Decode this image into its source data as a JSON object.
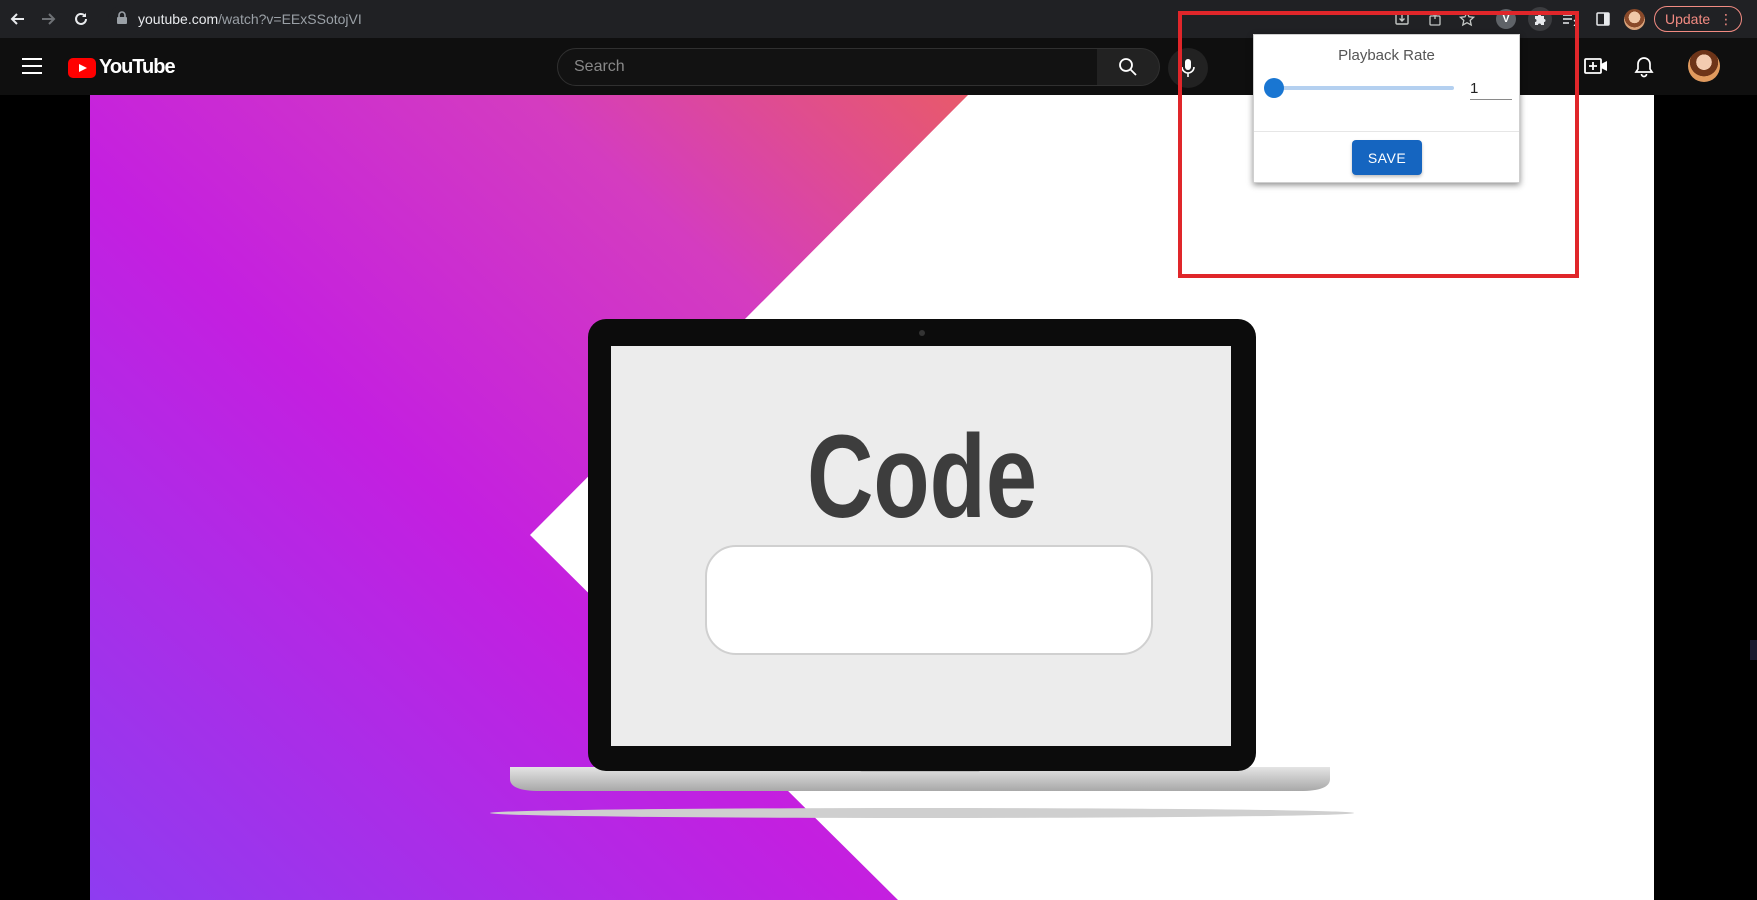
{
  "browser": {
    "url_domain": "youtube.com",
    "url_path": "/watch?v=EExSSotojVI",
    "extension_badge": "V",
    "update_label": "Update",
    "menu_glyph": "⋮"
  },
  "youtube": {
    "logo_text": "YouTube",
    "search_placeholder": "Search"
  },
  "video": {
    "thumbnail_word": "Code"
  },
  "popup": {
    "title": "Playback Rate",
    "rate_value": "1",
    "slider_level": 0.0,
    "save_label": "SAVE"
  },
  "colors": {
    "youtube_red": "#ff0000",
    "highlight_red": "#e0262a",
    "save_blue": "#1565c0",
    "slider_blue": "#1976d2",
    "update_border": "#f28b82"
  },
  "icons": {
    "back": "arrow-left-icon",
    "forward": "arrow-right-icon",
    "reload": "reload-icon",
    "lock": "lock-icon",
    "install": "install-icon",
    "share": "share-icon",
    "bookmark": "star-icon",
    "extensions": "puzzle-icon",
    "reading_list": "reading-list-icon",
    "sidepanel": "side-panel-icon",
    "menu": "hamburger-icon",
    "search": "search-icon",
    "mic": "microphone-icon",
    "create": "create-video-icon",
    "notifications": "bell-icon"
  }
}
